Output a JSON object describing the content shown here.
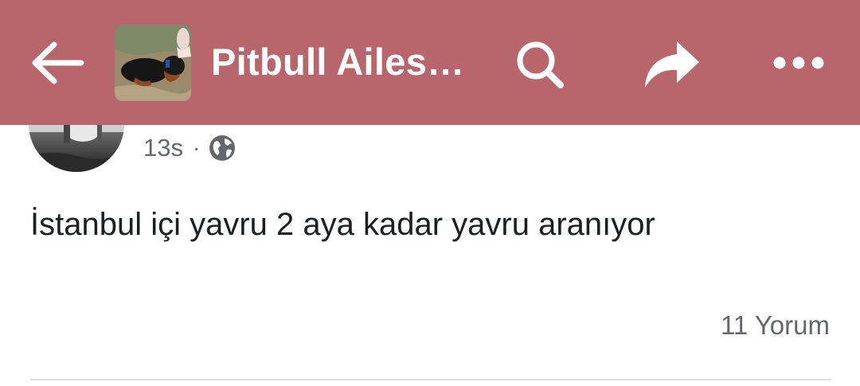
{
  "header": {
    "group_name": "Pitbull Ailes…",
    "background_color": "#b8666b",
    "icons": [
      "back-arrow-icon",
      "search-icon",
      "share-icon",
      "more-icon"
    ]
  },
  "post": {
    "time_ago": "13s",
    "separator": "·",
    "privacy_icon": "globe-icon",
    "text": "İstanbul içi yavru 2 aya kadar yavru aranıyor",
    "comments_label": "11 Yorum"
  }
}
